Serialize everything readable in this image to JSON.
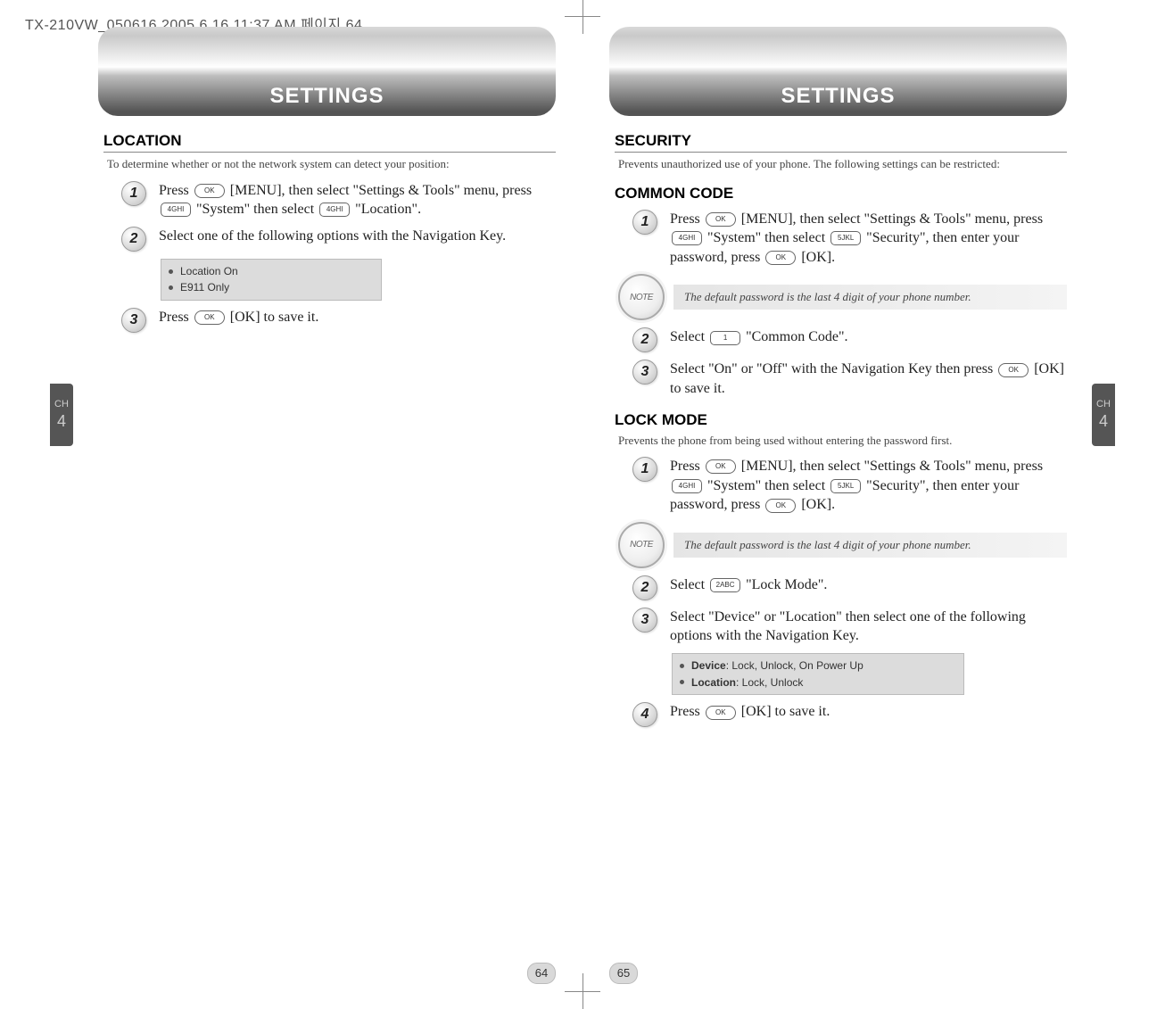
{
  "header_line": "TX-210VW_050616  2005.6.16 11:37 AM  페이지 64",
  "chapter_tab": {
    "label": "CH",
    "number": "4"
  },
  "left": {
    "banner": "SETTINGS",
    "section": "LOCATION",
    "intro": "To determine whether or not the network system can detect your position:",
    "steps": {
      "s1": {
        "num": "1",
        "a": "Press ",
        "ok": "OK",
        "b": " [MENU], then select \"Settings & Tools\" menu, press ",
        "k4": "4GHI",
        "c": " \"System\" then select ",
        "k4b": "4GHI",
        "d": " \"Location\"."
      },
      "s2": {
        "num": "2",
        "text": "Select one of the following options with the Navigation Key."
      },
      "s3": {
        "num": "3",
        "a": "Press ",
        "ok": "OK",
        "b": " [OK] to save it."
      }
    },
    "options": {
      "o1": "Location On",
      "o2": "E911 Only"
    },
    "page_num": "64"
  },
  "right": {
    "banner": "SETTINGS",
    "section": "SECURITY",
    "intro": "Prevents unauthorized use of your phone. The following settings can be restricted:",
    "common": {
      "title": "COMMON CODE",
      "s1": {
        "num": "1",
        "a": "Press ",
        "ok": "OK",
        "b": " [MENU], then select \"Settings & Tools\" menu, press ",
        "k4": "4GHI",
        "c": " \"System\" then select ",
        "k5": "5JKL",
        "d": " \"Security\", then enter your password, press ",
        "ok2": "OK",
        "e": " [OK]."
      },
      "note": "The default password is the last 4 digit of your phone number.",
      "s2": {
        "num": "2",
        "a": "Select ",
        "k1": "1",
        "b": " \"Common Code\"."
      },
      "s3": {
        "num": "3",
        "a": "Select \"On\" or \"Off\" with the Navigation Key then press ",
        "ok": "OK",
        "b": " [OK] to save it."
      }
    },
    "lock": {
      "title": "LOCK MODE",
      "intro": "Prevents the phone from being used without entering the password first.",
      "s1": {
        "num": "1",
        "a": "Press ",
        "ok": "OK",
        "b": " [MENU], then select \"Settings & Tools\" menu, press ",
        "k4": "4GHI",
        "c": " \"System\" then select ",
        "k5": "5JKL",
        "d": " \"Security\", then enter your password, press ",
        "ok2": "OK",
        "e": " [OK]."
      },
      "note": "The default password is the last 4 digit of your phone number.",
      "s2": {
        "num": "2",
        "a": "Select ",
        "k2": "2ABC",
        "b": " \"Lock Mode\"."
      },
      "s3": {
        "num": "3",
        "text": "Select \"Device\" or \"Location\" then select one of the following options with the Navigation Key."
      },
      "options": {
        "dev_label": "Device",
        "dev_vals": " : Lock, Unlock, On Power Up",
        "loc_label": "Location",
        "loc_vals": " : Lock, Unlock"
      },
      "s4": {
        "num": "4",
        "a": "Press ",
        "ok": "OK",
        "b": " [OK] to save it."
      }
    },
    "page_num": "65"
  },
  "note_badge": "NOTE"
}
